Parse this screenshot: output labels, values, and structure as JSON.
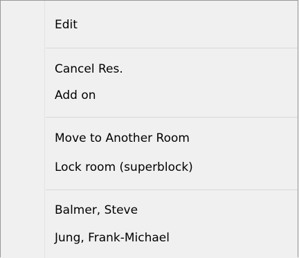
{
  "context_menu": {
    "groups": [
      {
        "items": [
          "Edit"
        ]
      },
      {
        "items": [
          "Cancel Res.",
          "Add on"
        ]
      },
      {
        "items": [
          "Move to Another Room",
          "Lock room (superblock)"
        ]
      },
      {
        "items": [
          "Balmer, Steve",
          "Jung, Frank-Michael"
        ]
      }
    ]
  },
  "colors": {
    "background": "#f0f0f0",
    "border": "#979797",
    "separator": "#d7d7d7",
    "gutter_line": "#e2e3e3",
    "text": "#000000"
  }
}
